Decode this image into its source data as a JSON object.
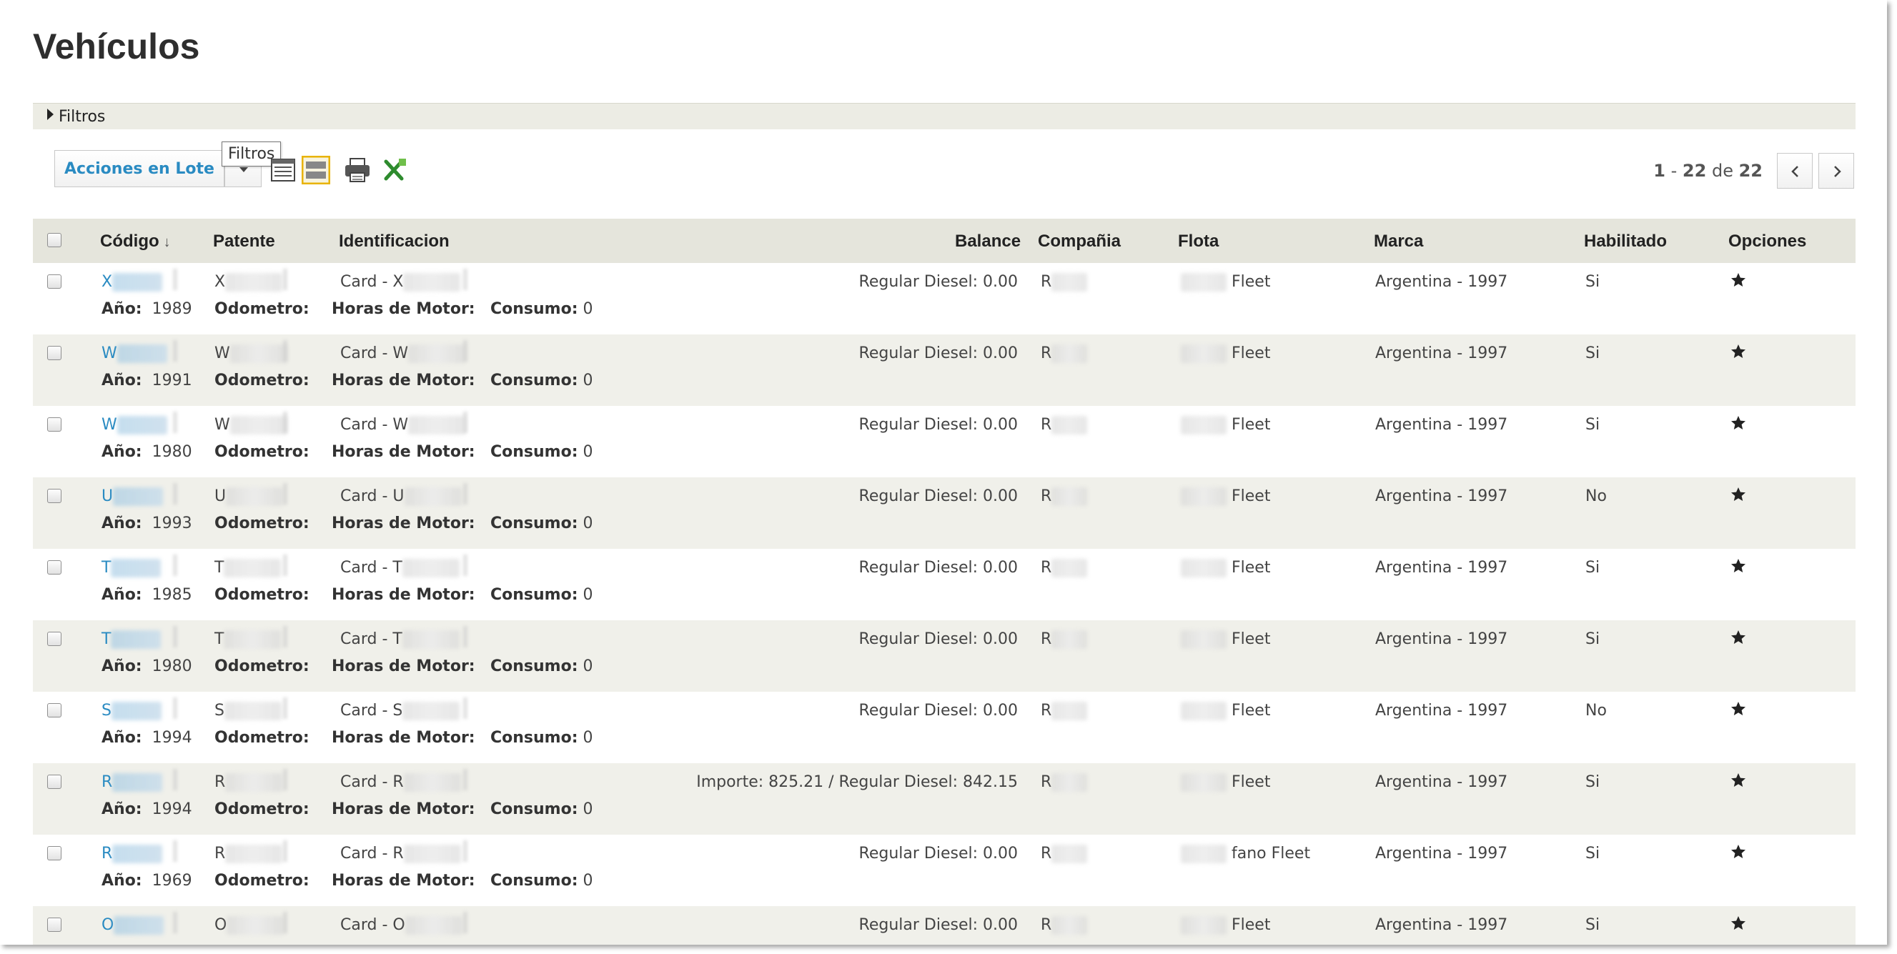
{
  "page": {
    "title": "Vehículos"
  },
  "filters": {
    "label": "Filtros",
    "tooltip": "Filtros"
  },
  "toolbar": {
    "batch_label": "Acciones en Lote",
    "icons": [
      "list-view-icon",
      "grid-view-icon",
      "print-icon",
      "excel-export-icon"
    ]
  },
  "pager": {
    "start": "1",
    "sep": " - ",
    "end": "22",
    "of": " de ",
    "total": "22"
  },
  "columns": {
    "codigo": "Código",
    "patente": "Patente",
    "identificacion": "Identificacion",
    "balance": "Balance",
    "compania": "Compañia",
    "flota": "Flota",
    "marca": "Marca",
    "habilitado": "Habilitado",
    "opciones": "Opciones"
  },
  "row_labels": {
    "anio": "Año:",
    "odometro": "Odometro:",
    "horas": "Horas de Motor:",
    "consumo": "Consumo:"
  },
  "colors": {
    "link": "#2a8bc2",
    "header_bg": "#e5e5dc",
    "alt_row_bg": "#f0f0ea",
    "view_active": "#e8b300"
  },
  "rows": [
    {
      "codigo": "X",
      "patente": "X",
      "ident": "Card - X",
      "balance": "Regular Diesel: 0.00",
      "compania": "R",
      "flota": "Fleet",
      "marca": "Argentina - 1997",
      "habilitado": "Si",
      "anio": "1989",
      "consumo": "0"
    },
    {
      "codigo": "W",
      "patente": "W",
      "ident": "Card - W",
      "balance": "Regular Diesel: 0.00",
      "compania": "R",
      "flota": "Fleet",
      "marca": "Argentina - 1997",
      "habilitado": "Si",
      "anio": "1991",
      "consumo": "0"
    },
    {
      "codigo": "W",
      "patente": "W",
      "ident": "Card - W",
      "balance": "Regular Diesel: 0.00",
      "compania": "R",
      "flota": "Fleet",
      "marca": "Argentina - 1997",
      "habilitado": "Si",
      "anio": "1980",
      "consumo": "0"
    },
    {
      "codigo": "U",
      "patente": "U",
      "ident": "Card - U",
      "balance": "Regular Diesel: 0.00",
      "compania": "R",
      "flota": "Fleet",
      "marca": "Argentina - 1997",
      "habilitado": "No",
      "anio": "1993",
      "consumo": "0"
    },
    {
      "codigo": "T",
      "patente": "T",
      "ident": "Card - T",
      "balance": "Regular Diesel: 0.00",
      "compania": "R",
      "flota": "Fleet",
      "marca": "Argentina - 1997",
      "habilitado": "Si",
      "anio": "1985",
      "consumo": "0"
    },
    {
      "codigo": "T",
      "patente": "T",
      "ident": "Card - T",
      "balance": "Regular Diesel: 0.00",
      "compania": "R",
      "flota": "Fleet",
      "marca": "Argentina - 1997",
      "habilitado": "Si",
      "anio": "1980",
      "consumo": "0"
    },
    {
      "codigo": "S",
      "patente": "S",
      "ident": "Card - S",
      "balance": "Regular Diesel: 0.00",
      "compania": "R",
      "flota": "Fleet",
      "marca": "Argentina - 1997",
      "habilitado": "No",
      "anio": "1994",
      "consumo": "0"
    },
    {
      "codigo": "R",
      "patente": "R",
      "ident": "Card - R",
      "balance": "Importe: 825.21 / Regular Diesel: 842.15",
      "compania": "R",
      "flota": "Fleet",
      "marca": "Argentina - 1997",
      "habilitado": "Si",
      "anio": "1994",
      "consumo": "0"
    },
    {
      "codigo": "R",
      "patente": "R",
      "ident": "Card - R",
      "balance": "Regular Diesel: 0.00",
      "compania": "R",
      "flota": "fano Fleet",
      "marca": "Argentina - 1997",
      "habilitado": "Si",
      "anio": "1969",
      "consumo": "0"
    },
    {
      "codigo": "O",
      "patente": "O",
      "ident": "Card - O",
      "balance": "Regular Diesel: 0.00",
      "compania": "R",
      "flota": "Fleet",
      "marca": "Argentina - 1997",
      "habilitado": "Si",
      "anio": "",
      "consumo": ""
    }
  ]
}
